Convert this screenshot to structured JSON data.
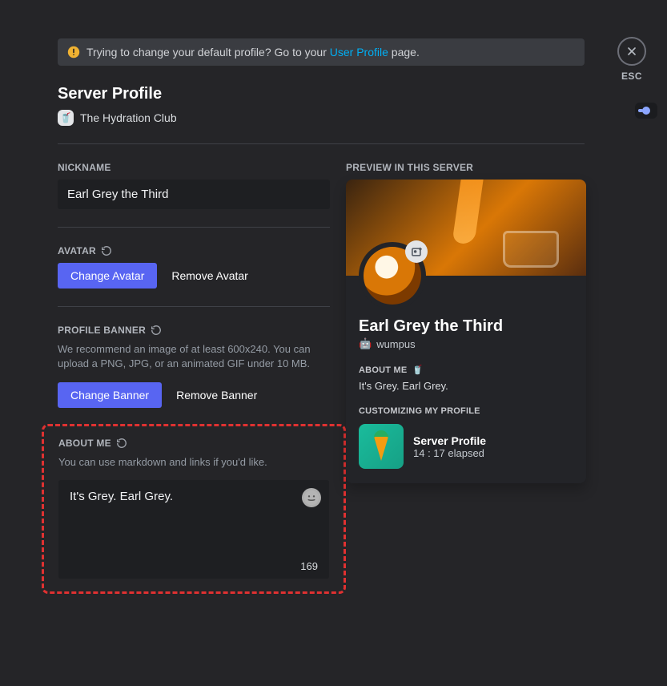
{
  "notice": {
    "text_before": "Trying to change your default profile? Go to your ",
    "link_text": "User Profile",
    "text_after": " page."
  },
  "esc_label": "ESC",
  "page_title": "Server Profile",
  "server": {
    "icon_emoji": "🥤",
    "name": "The Hydration Club"
  },
  "nickname": {
    "label": "NICKNAME",
    "value": "Earl Grey the Third"
  },
  "avatar": {
    "label": "AVATAR",
    "change": "Change Avatar",
    "remove": "Remove Avatar"
  },
  "banner": {
    "label": "PROFILE BANNER",
    "hint": "We recommend an image of at least 600x240. You can upload a PNG, JPG, or an animated GIF under 10 MB.",
    "change": "Change Banner",
    "remove": "Remove Banner"
  },
  "about": {
    "label": "ABOUT ME",
    "hint": "You can use markdown and links if you'd like.",
    "value": "It's Grey. Earl Grey.",
    "char_remaining": "169"
  },
  "preview": {
    "label": "PREVIEW IN THIS SERVER",
    "display_name": "Earl Grey the Third",
    "username_icon": "🤖",
    "username": "wumpus",
    "about_label": "ABOUT ME",
    "about_emoji": "🥤",
    "about_text": "It's Grey. Earl Grey.",
    "activity_label": "CUSTOMIZING MY PROFILE",
    "activity_title": "Server Profile",
    "activity_time": "14 : 17 elapsed"
  }
}
